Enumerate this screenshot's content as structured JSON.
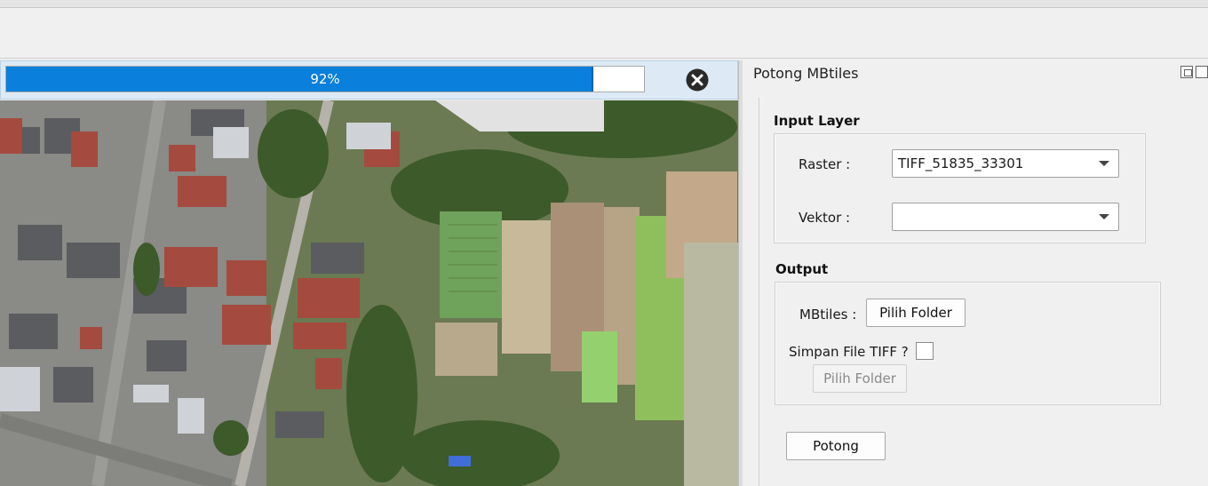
{
  "progress": {
    "value": 0.92,
    "label": "92%"
  },
  "dock": {
    "title": "Potong MBtiles",
    "input_section": {
      "title": "Input Layer",
      "raster_label": "Raster :",
      "raster_value": "TIFF_51835_33301",
      "vektor_label": "Vektor :",
      "vektor_value": ""
    },
    "output_section": {
      "title": "Output",
      "mbtiles_label": "MBtiles :",
      "mbtiles_button": "Pilih Folder",
      "save_tiff_label": "Simpan File TIFF ?",
      "save_tiff_checked": false,
      "tiff_folder_button": "Pilih Folder"
    },
    "run_button": "Potong"
  },
  "colors": {
    "progress_fill": "#0a7fdc",
    "progress_bg": "#ddeaf6"
  },
  "icons": [
    "cancel-icon",
    "dock-float-icon",
    "dock-close-icon",
    "chevron-down-icon"
  ]
}
